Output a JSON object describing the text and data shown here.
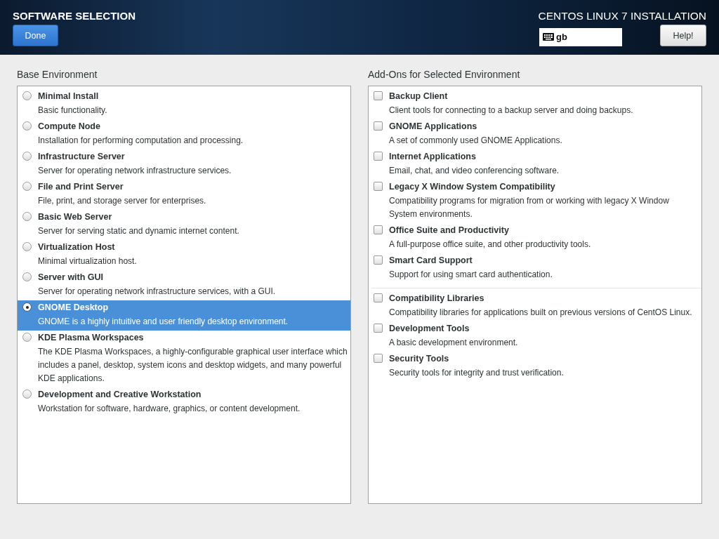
{
  "header": {
    "title": "SOFTWARE SELECTION",
    "done_button": "Done",
    "product": "CENTOS LINUX 7 INSTALLATION",
    "keyboard_layout": "gb",
    "help_button": "Help!"
  },
  "base_environment": {
    "heading": "Base Environment",
    "items": [
      {
        "name": "Minimal Install",
        "description": "Basic functionality.",
        "selected": false
      },
      {
        "name": "Compute Node",
        "description": "Installation for performing computation and processing.",
        "selected": false
      },
      {
        "name": "Infrastructure Server",
        "description": "Server for operating network infrastructure services.",
        "selected": false
      },
      {
        "name": "File and Print Server",
        "description": "File, print, and storage server for enterprises.",
        "selected": false
      },
      {
        "name": "Basic Web Server",
        "description": "Server for serving static and dynamic internet content.",
        "selected": false
      },
      {
        "name": "Virtualization Host",
        "description": "Minimal virtualization host.",
        "selected": false
      },
      {
        "name": "Server with GUI",
        "description": "Server for operating network infrastructure services, with a GUI.",
        "selected": false
      },
      {
        "name": "GNOME Desktop",
        "description": "GNOME is a highly intuitive and user friendly desktop environment.",
        "selected": true
      },
      {
        "name": "KDE Plasma Workspaces",
        "description": "The KDE Plasma Workspaces, a highly-configurable graphical user interface which includes a panel, desktop, system icons and desktop widgets, and many powerful KDE applications.",
        "selected": false
      },
      {
        "name": "Development and Creative Workstation",
        "description": "Workstation for software, hardware, graphics, or content development.",
        "selected": false
      }
    ]
  },
  "addons": {
    "heading": "Add-Ons for Selected Environment",
    "groups": [
      {
        "items": [
          {
            "name": "Backup Client",
            "description": "Client tools for connecting to a backup server and doing backups.",
            "checked": false
          },
          {
            "name": "GNOME Applications",
            "description": "A set of commonly used GNOME Applications.",
            "checked": false
          },
          {
            "name": "Internet Applications",
            "description": "Email, chat, and video conferencing software.",
            "checked": false
          },
          {
            "name": "Legacy X Window System Compatibility",
            "description": "Compatibility programs for migration from or working with legacy X Window System environments.",
            "checked": false
          },
          {
            "name": "Office Suite and Productivity",
            "description": "A full-purpose office suite, and other productivity tools.",
            "checked": false
          },
          {
            "name": "Smart Card Support",
            "description": "Support for using smart card authentication.",
            "checked": false
          }
        ]
      },
      {
        "items": [
          {
            "name": "Compatibility Libraries",
            "description": "Compatibility libraries for applications built on previous versions of CentOS Linux.",
            "checked": false
          },
          {
            "name": "Development Tools",
            "description": "A basic development environment.",
            "checked": false
          },
          {
            "name": "Security Tools",
            "description": "Security tools for integrity and trust verification.",
            "checked": false
          }
        ]
      }
    ]
  }
}
